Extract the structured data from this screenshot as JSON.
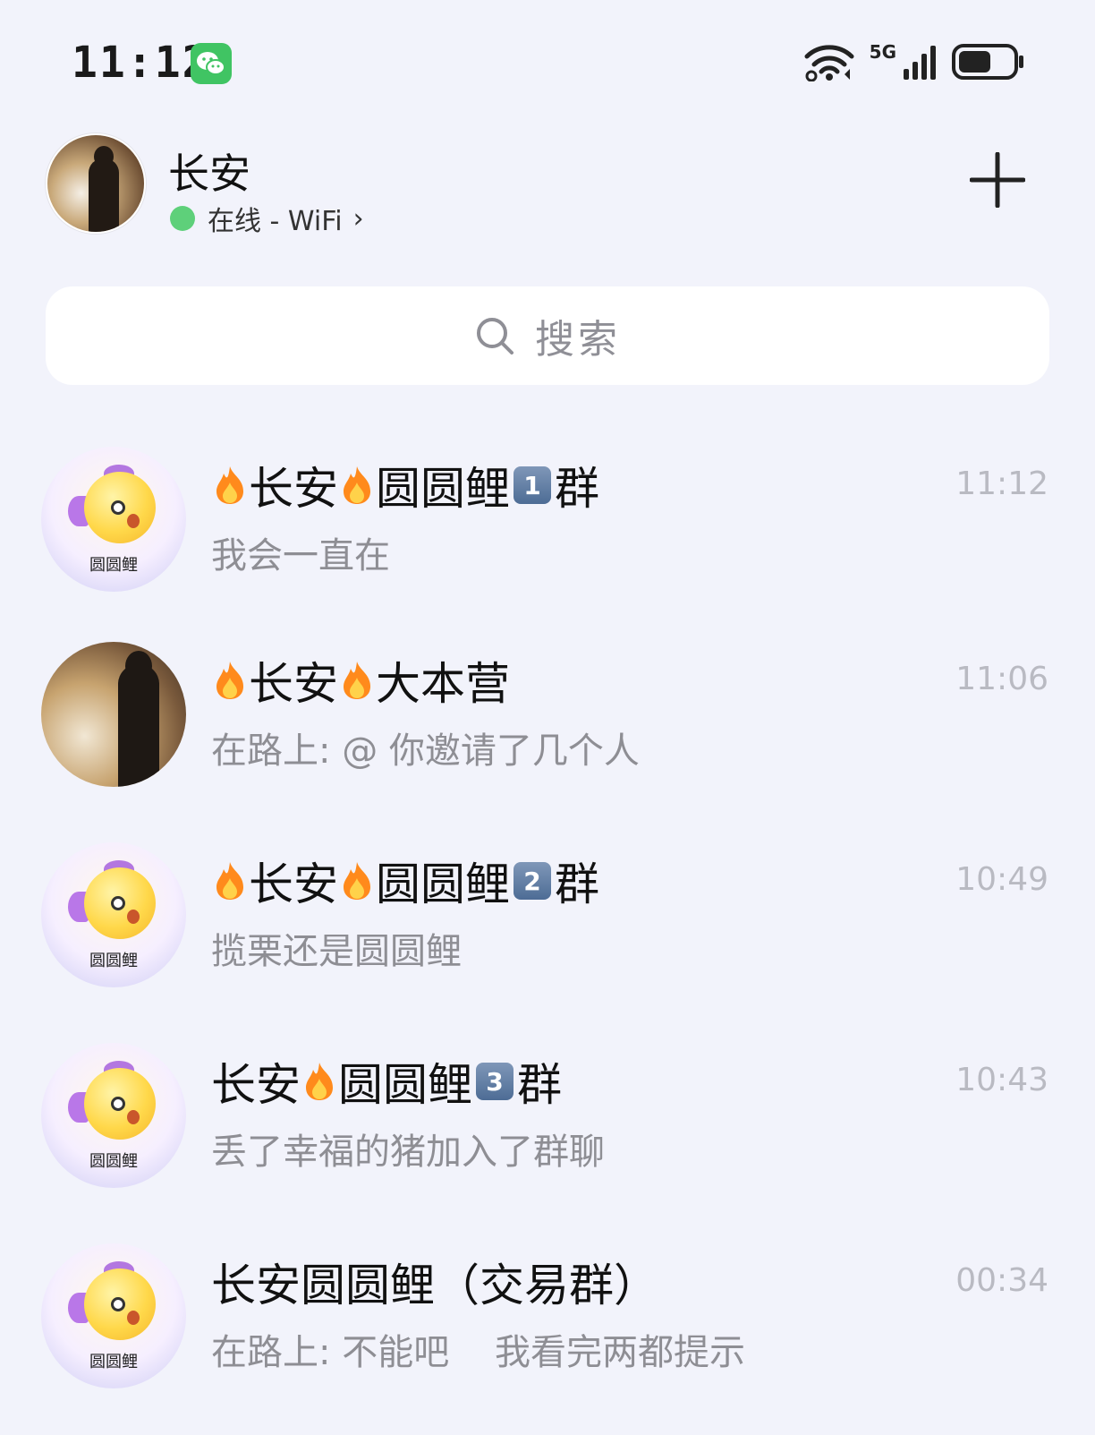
{
  "status_bar": {
    "time": "11:12",
    "network": "5G",
    "icons": [
      "wechat-notification-icon",
      "wifi-icon",
      "signal-icon",
      "battery-icon"
    ],
    "battery_level": 0.6
  },
  "header": {
    "name": "长安",
    "status_text": "在线 - WiFi",
    "status_chevron": "›",
    "online_color": "#5ed07a"
  },
  "search": {
    "placeholder": "搜索"
  },
  "conversations": [
    {
      "title_parts": [
        "fire",
        "长安",
        "fire",
        "圆圆鲤",
        "badge:1",
        "群"
      ],
      "title_text": "长安圆圆鲤1群",
      "pre_a": "长安",
      "pre_b": "圆圆鲤",
      "badge": "1",
      "post": "群",
      "preview": "我会一直在",
      "time": "11:12",
      "avatar": "koi",
      "avatar_label": "圆圆鲤"
    },
    {
      "pre_a": "长安",
      "pre_b": "大本营",
      "preview": "在路上: @ 你邀请了几个人",
      "time": "11:06",
      "avatar": "photo"
    },
    {
      "pre_a": "长安",
      "pre_b": "圆圆鲤",
      "badge": "2",
      "post": "群",
      "preview": "揽栗还是圆圆鲤",
      "time": "10:49",
      "avatar": "koi",
      "avatar_label": "圆圆鲤"
    },
    {
      "pre_a": "长安",
      "pre_b": "圆圆鲤",
      "badge": "3",
      "post": "群",
      "preview": "丢了幸福的猪加入了群聊",
      "time": "10:43",
      "avatar": "koi",
      "avatar_label": "圆圆鲤"
    },
    {
      "title": "长安圆圆鲤（交易群）",
      "preview": "在路上: 不能吧    我看完两都提示",
      "time": "00:34",
      "avatar": "koi",
      "avatar_label": "圆圆鲤"
    }
  ]
}
